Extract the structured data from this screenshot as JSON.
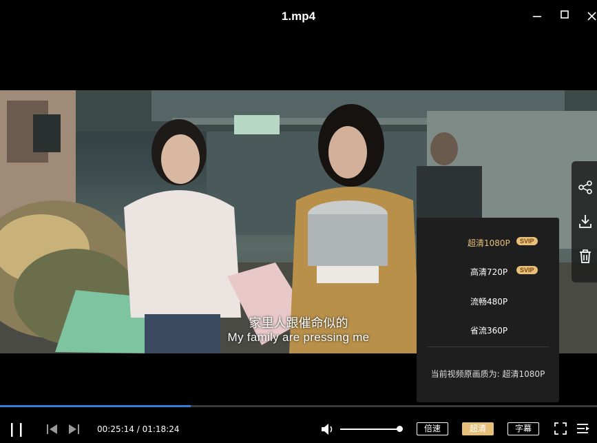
{
  "window": {
    "title": "1.mp4"
  },
  "subtitles": {
    "chinese": "家里人跟催命似的",
    "english": "My family are pressing me"
  },
  "quality_menu": {
    "options": [
      {
        "label": "超清1080P",
        "badge": "SVIP",
        "selected": true
      },
      {
        "label": "高清720P",
        "badge": "SVIP",
        "selected": false
      },
      {
        "label": "流畅480P",
        "badge": "",
        "selected": false
      },
      {
        "label": "省流360P",
        "badge": "",
        "selected": false
      }
    ],
    "current_note": "当前视频原画质为: 超清1080P"
  },
  "playback": {
    "current_time": "00:25:14",
    "separator": "/",
    "duration": "01:18:24",
    "progress_fraction": 0.32,
    "volume_fraction": 1.0
  },
  "controls": {
    "speed_label": "倍速",
    "quality_label": "超清",
    "subtitle_label": "字幕"
  },
  "side_actions": [
    "share-icon",
    "download-icon",
    "delete-icon"
  ],
  "colors": {
    "accent_gold": "#e6c07a",
    "progress_blue": "#2f80d8",
    "menu_bg": "#1e1e1e"
  }
}
